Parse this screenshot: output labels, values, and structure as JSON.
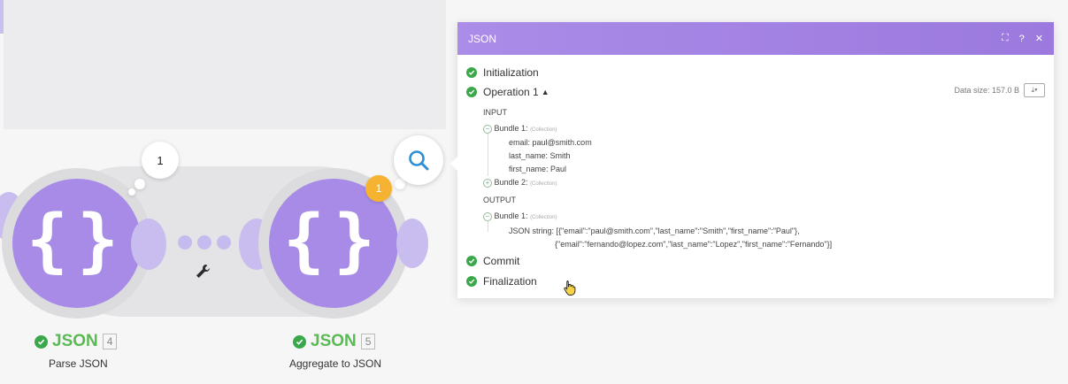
{
  "scenario": {
    "route_count": "1",
    "operations_badge": "1",
    "modules": [
      {
        "name": "JSON",
        "id": "4",
        "subtitle": "Parse JSON"
      },
      {
        "name": "JSON",
        "id": "5",
        "subtitle": "Aggregate to JSON"
      }
    ]
  },
  "popup": {
    "title": "JSON",
    "head_icons": [
      "expand-icon",
      "help-icon",
      "close-icon"
    ],
    "steps": {
      "initialization": "Initialization",
      "operation": "Operation 1",
      "commit": "Commit",
      "finalization": "Finalization"
    },
    "data_size": "Data size: 157.0 B",
    "input_label": "INPUT",
    "output_label": "OUTPUT",
    "collection_tag": "(Collection)",
    "input_bundles": [
      {
        "label": "Bundle 1:",
        "fields": [
          {
            "key": "email:",
            "value": "paul@smith.com"
          },
          {
            "key": "last_name:",
            "value": "Smith"
          },
          {
            "key": "first_name:",
            "value": "Paul"
          }
        ]
      },
      {
        "label": "Bundle 2:",
        "fields": []
      }
    ],
    "output_bundle": {
      "label": "Bundle 1:",
      "key": "JSON string:",
      "line1": "[{\"email\":\"paul@smith.com\",\"last_name\":\"Smith\",\"first_name\":\"Paul\"},",
      "line2": "{\"email\":\"fernando@lopez.com\",\"last_name\":\"Lopez\",\"first_name\":\"Fernando\"}]"
    }
  },
  "colors": {
    "accent": "#a78be6",
    "success": "#3aa84a",
    "badge": "#f5b331"
  }
}
